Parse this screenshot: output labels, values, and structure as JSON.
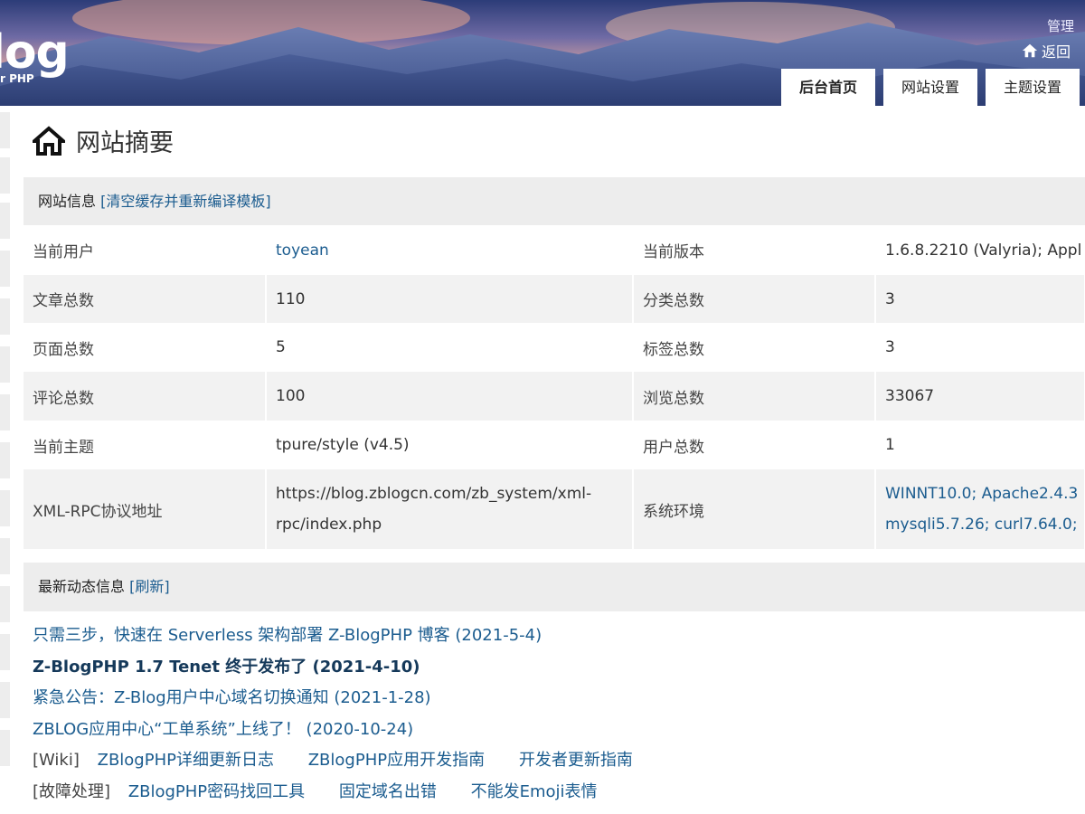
{
  "header": {
    "logo_text": "log",
    "logo_sub": "r PHP",
    "admin_label": "管理",
    "back_label": "返回",
    "tabs": [
      {
        "label": "后台首页",
        "active": true
      },
      {
        "label": "网站设置",
        "active": false
      },
      {
        "label": "主题设置",
        "active": false
      }
    ]
  },
  "page_title": "网站摘要",
  "site_info": {
    "heading": "网站信息",
    "action": "[清空缓存并重新编译模板]",
    "rows": [
      {
        "l1": "当前用户",
        "v1": "toyean",
        "l2": "当前版本",
        "v2": "1.6.8.2210 (Valyria); Appl"
      },
      {
        "l1": "文章总数",
        "v1": "110",
        "l2": "分类总数",
        "v2": "3"
      },
      {
        "l1": "页面总数",
        "v1": "5",
        "l2": "标签总数",
        "v2": "3"
      },
      {
        "l1": "评论总数",
        "v1": "100",
        "l2": "浏览总数",
        "v2": "33067"
      },
      {
        "l1": "当前主题",
        "v1": "tpure/style (v4.5)",
        "l2": "用户总数",
        "v2": "1"
      },
      {
        "l1": "XML-RPC协议地址",
        "v1a": "https://blog.zblogcn.com/zb_system/xml-",
        "v1b": "rpc/index.php",
        "l2": "系统环境",
        "v2a": "WINNT10.0; Apache2.4.3",
        "v2b": "mysqli5.7.26; curl7.64.0;"
      }
    ]
  },
  "news": {
    "heading": "最新动态信息",
    "action": "[刷新]",
    "items": [
      "只需三步，快速在 Serverless 架构部署 Z-BlogPHP 博客 (2021-5-4)",
      "Z-BlogPHP 1.7 Tenet 终于发布了 (2021-4-10)",
      "紧急公告：Z-Blog用户中心域名切换通知 (2021-1-28)",
      "ZBLOG应用中心“工单系统”上线了！ (2020-10-24)"
    ],
    "wiki": {
      "tag": "[Wiki]",
      "links": [
        "ZBlogPHP详细更新日志",
        "ZBlogPHP应用开发指南",
        "开发者更新指南"
      ]
    },
    "faq": {
      "tag": "[故障处理]",
      "links": [
        "ZBlogPHP密码找回工具",
        "固定域名出错",
        "不能发Emoji表情"
      ]
    }
  },
  "colors": {
    "link": "#1b5c8f",
    "section_bg": "#ededed",
    "row_alt": "#f2f2f2"
  }
}
